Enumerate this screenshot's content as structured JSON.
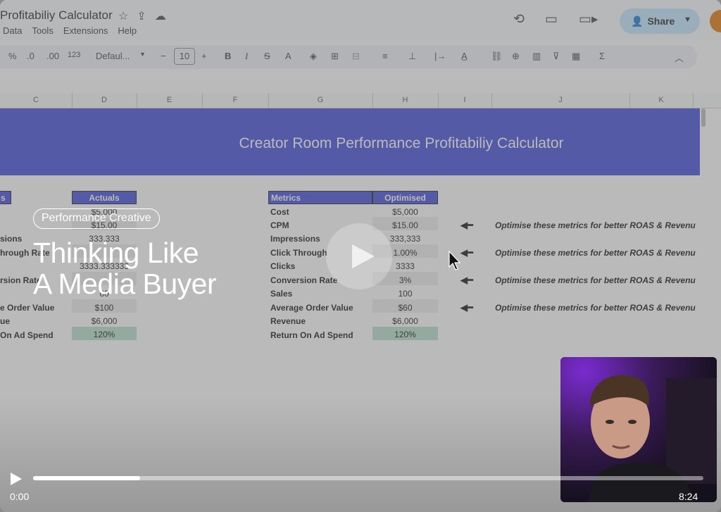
{
  "doc": {
    "title": "Profitabiliy Calculator"
  },
  "menu": [
    "Data",
    "Tools",
    "Extensions",
    "Help"
  ],
  "share": {
    "label": "Share"
  },
  "toolbar": {
    "percent": "%",
    "dec_less": ".0",
    "dec_more": ".00",
    "format": "123",
    "font": "Defaul...",
    "minus": "−",
    "size": "10",
    "plus": "+",
    "bold": "B",
    "italic": "I",
    "strike": "S",
    "text_a": "A",
    "sigma": "Σ"
  },
  "columns": [
    "C",
    "D",
    "E",
    "F",
    "G",
    "H",
    "I",
    "J",
    "K"
  ],
  "sheet": {
    "banner": "Creator Room Performance Profitabiliy Calculator",
    "left_header_edge": "s",
    "actuals_header": "Actuals",
    "left_labels": [
      "",
      "sions",
      "hrough Rate",
      "",
      "rsion Rate",
      "",
      "e Order Value",
      "ue",
      "On Ad Spend"
    ],
    "actuals_values": [
      "$5,000",
      "$15.00",
      "333,333",
      "",
      "3333.333333",
      "",
      "60",
      "$100",
      "$6,000",
      "120%"
    ],
    "metrics_header": "Metrics",
    "optimised_header": "Optimised",
    "metrics": [
      "Cost",
      "CPM",
      "Impressions",
      "Click Through",
      "Clicks",
      "Conversion Rate",
      "Sales",
      "Average Order Value",
      "Revenue",
      "Return On Ad Spend"
    ],
    "optimised": [
      "$5,000",
      "$15.00",
      "333,333",
      "1.00%",
      "3333",
      "3%",
      "100",
      "$60",
      "$6,000",
      "120%"
    ],
    "note": "Optimise these metrics for better ROAS & Revenu",
    "arrow": "🡐"
  },
  "overlay": {
    "pill": "Performance Creative",
    "headline_1": "Thinking Like",
    "headline_2": "A Media Buyer"
  },
  "player": {
    "current": "0:00",
    "total": "8:24",
    "progress_fraction": 0.16
  }
}
